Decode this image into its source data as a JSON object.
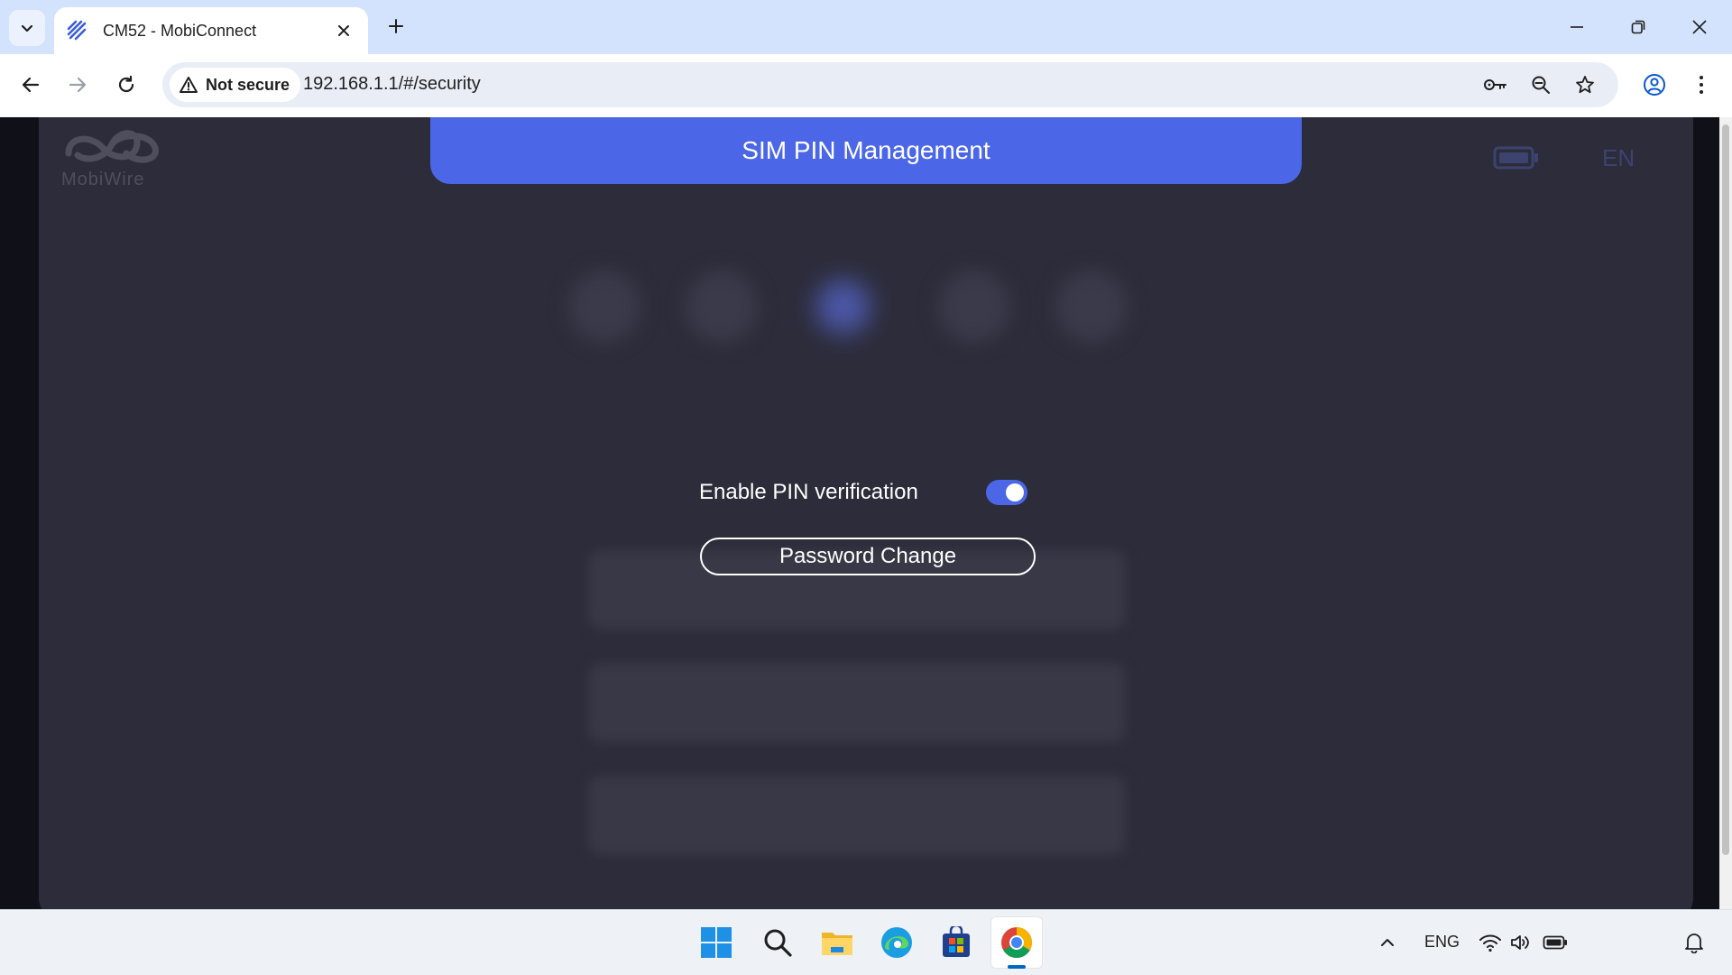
{
  "browser": {
    "tab_title": "CM52 - MobiConnect",
    "security_label": "Not secure",
    "url": "192.168.1.1/#/security"
  },
  "page": {
    "logo_text": "MobiWire",
    "language": "EN",
    "modal_title": "SIM PIN Management",
    "pin_verification_label": "Enable PIN verification",
    "pin_verification_enabled": true,
    "password_change_label": "Password Change"
  },
  "taskbar": {
    "language_indicator": "ENG"
  },
  "colors": {
    "accent": "#4b67e8",
    "panel": "#2c2c3a",
    "tabstrip": "#d3e3fd"
  },
  "icons": [
    "chevron-down-icon",
    "mobiconnect-favicon-icon",
    "close-icon",
    "plus-icon",
    "minimize-icon",
    "restore-icon",
    "back-icon",
    "forward-icon",
    "reload-icon",
    "warning-icon",
    "key-icon",
    "zoom-out-icon",
    "star-icon",
    "profile-icon",
    "menu-icon",
    "battery-icon",
    "windows-start-icon",
    "search-icon",
    "file-explorer-icon",
    "edge-icon",
    "store-icon",
    "chrome-icon",
    "chevron-up-icon",
    "wifi-icon",
    "volume-icon",
    "notification-bell-icon"
  ]
}
